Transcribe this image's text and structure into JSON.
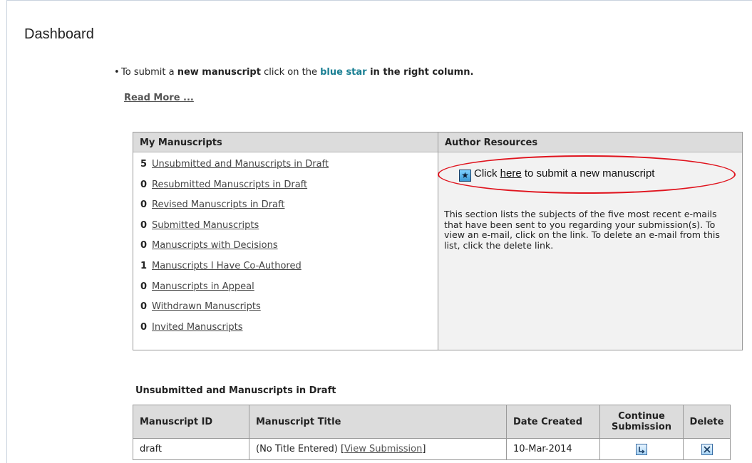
{
  "page": {
    "title": "Dashboard"
  },
  "intro": {
    "bullet": "•",
    "text_1": "To submit a ",
    "bold_1": "new manuscript",
    "text_2": " click on the ",
    "blue_star": "blue star",
    "bold_2": " in the right column.",
    "read_more": "Read More ..."
  },
  "my_manuscripts": {
    "heading": "My Manuscripts",
    "items": [
      {
        "count": "5",
        "label": "Unsubmitted and Manuscripts in Draft"
      },
      {
        "count": "0",
        "label": "Resubmitted Manuscripts in Draft"
      },
      {
        "count": "0",
        "label": "Revised Manuscripts in Draft"
      },
      {
        "count": "0",
        "label": "Submitted Manuscripts"
      },
      {
        "count": "0",
        "label": "Manuscripts with Decisions"
      },
      {
        "count": "1",
        "label": "Manuscripts I Have Co-Authored"
      },
      {
        "count": "0",
        "label": "Manuscripts in Appeal"
      },
      {
        "count": "0",
        "label": "Withdrawn Manuscripts"
      },
      {
        "count": "0",
        "label": "Invited Manuscripts"
      }
    ]
  },
  "author_resources": {
    "heading": "Author Resources",
    "star_glyph": "★",
    "click_text": "Click ",
    "here_link": "here",
    "submit_text": " to submit a new manuscript",
    "description": "This section lists the subjects of the five most recent e-mails that have been sent to you regarding your submission(s). To view an e-mail, click on the link. To delete an e-mail from this list, click the delete link."
  },
  "drafts": {
    "section_title": "Unsubmitted and Manuscripts in Draft",
    "headers": {
      "id": "Manuscript ID",
      "title": "Manuscript Title",
      "date": "Date Created",
      "continue": "Continue Submission",
      "delete": "Delete"
    },
    "rows": [
      {
        "id": "draft",
        "title": "(No Title Entered) ",
        "view_open": "[",
        "view_link": "View Submission",
        "view_close": "]",
        "date": "10-Mar-2014",
        "continue_icon": "continue-submission-icon",
        "delete_icon": "delete-icon"
      }
    ]
  },
  "colors": {
    "accent_blue": "#1a7f93",
    "highlight_red": "#e0141e",
    "header_gray": "#dcdcdc"
  }
}
